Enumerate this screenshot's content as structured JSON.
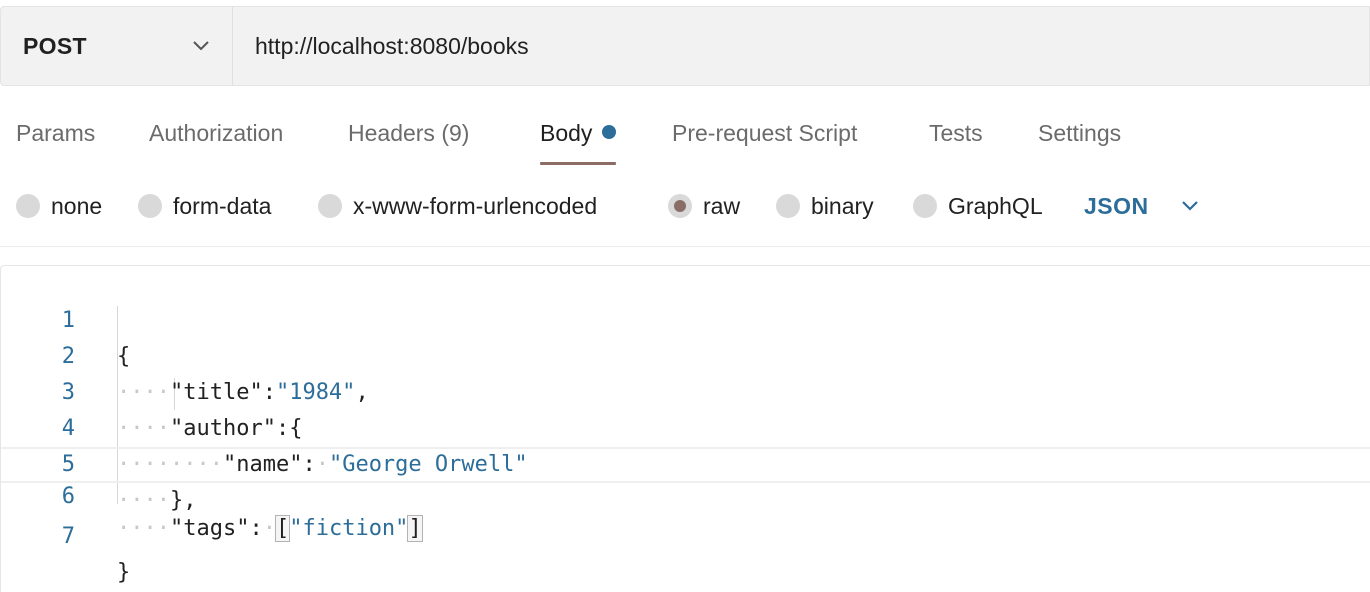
{
  "request": {
    "method": "POST",
    "url": "http://localhost:8080/books"
  },
  "tabs": [
    {
      "label": "Params",
      "active": false
    },
    {
      "label": "Authorization",
      "active": false
    },
    {
      "label": "Headers",
      "count": "(9)",
      "active": false
    },
    {
      "label": "Body",
      "active": true,
      "indicator": "modified-dot"
    },
    {
      "label": "Pre-request Script",
      "active": false
    },
    {
      "label": "Tests",
      "active": false
    },
    {
      "label": "Settings",
      "active": false
    }
  ],
  "body_types": [
    {
      "label": "none",
      "checked": false
    },
    {
      "label": "form-data",
      "checked": false
    },
    {
      "label": "x-www-form-urlencoded",
      "checked": false
    },
    {
      "label": "raw",
      "checked": true
    },
    {
      "label": "binary",
      "checked": false
    },
    {
      "label": "GraphQL",
      "checked": false
    }
  ],
  "format": "JSON",
  "editor": {
    "line_numbers": [
      "1",
      "2",
      "3",
      "4",
      "5",
      "6",
      "7"
    ],
    "lines": {
      "l1": "{",
      "l2_key": "\"title\"",
      "l2_sep": ":",
      "l2_val": "\"1984\"",
      "l2_end": ",",
      "l3_key": "\"author\"",
      "l3_sep": ":",
      "l3_end": "{",
      "l4_key": "\"name\"",
      "l4_sep": ":",
      "l4_val": "\"George Orwell\"",
      "l5": "},",
      "l6_key": "\"tags\"",
      "l6_sep": ":",
      "l6_open": "[",
      "l6_val": "\"fiction\"",
      "l6_close": "]",
      "l7": "}"
    }
  },
  "colors": {
    "accent_blue": "#2c6d99",
    "tab_underline": "#8b6d66",
    "radio_checked": "#8a6d66",
    "bar_background": "#f2f2f2"
  }
}
